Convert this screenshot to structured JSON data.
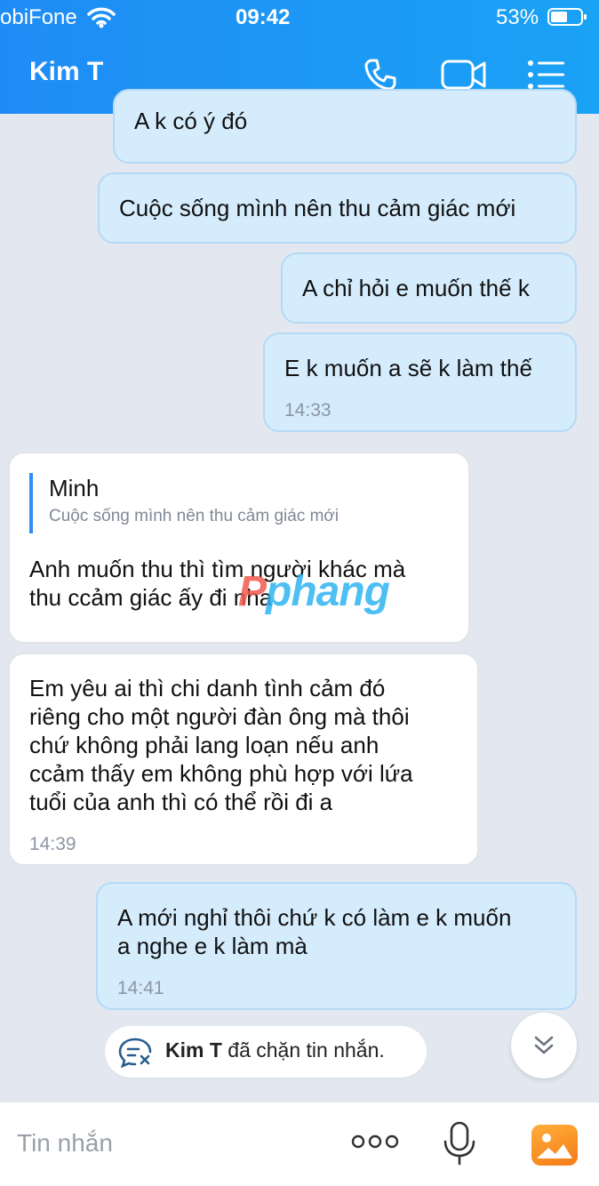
{
  "status_bar": {
    "carrier": "obiFone",
    "time": "09:42",
    "battery": "53%"
  },
  "header": {
    "title": "Kim T",
    "icons": [
      "phone-icon",
      "video-call-icon",
      "menu-list-icon"
    ]
  },
  "messages": [
    {
      "side": "me",
      "text": "A k có ý đó"
    },
    {
      "side": "me",
      "text": "Cuộc sống mình nên thu cảm giác mới"
    },
    {
      "side": "me",
      "text": "A chỉ hỏi e muốn thế k"
    },
    {
      "side": "me",
      "text": "E k muốn a sẽ k làm thế",
      "time": "14:33"
    },
    {
      "side": "them",
      "quote_name": "Minh",
      "quote_text": "Cuộc sống mình nên thu cảm giác mới",
      "text": "Anh muốn thu thì tìm người khác mà\nthu ccảm giác ấy đi nha"
    },
    {
      "side": "them",
      "text": "Em yêu ai thì chi danh tình cảm đó\nriêng cho một người đàn ông mà thôi\nchứ không phải lang loạn nếu anh\nccảm thấy em không phù hợp với lứa\ntuổi của anh thì có thể rồi đi a",
      "time": "14:39"
    },
    {
      "side": "me",
      "text": "A mới nghỉ thôi chứ k có làm e k muốn\na nghe e k làm mà",
      "time": "14:41"
    }
  ],
  "watermark": {
    "part1": "P",
    "part2": "phang"
  },
  "blocked_notice": {
    "name": "Kim T",
    "text": " đã chặn tin nhắn."
  },
  "composer": {
    "placeholder": "Tin nhắn"
  },
  "colors": {
    "header": "#1f8cf5",
    "my_bubble": "#d5ecfd",
    "their_bubble": "#ffffff",
    "accent": "#2e8ef6"
  }
}
